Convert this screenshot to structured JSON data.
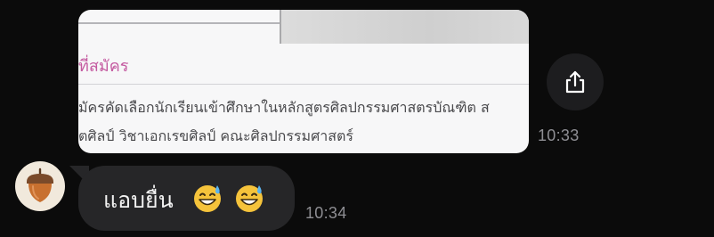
{
  "image_message": {
    "heading": "ที่สมัคร",
    "line1": "มัครคัดเลือกนักเรียนเข้าศึกษาในหลักสูตรศิลปกรรมศาสตรบัณฑิต ส",
    "line2": "ตศิลป์ วิชาเอกเรขศิลป์ คณะศิลปกรรมศาสตร์",
    "time": "10:33"
  },
  "share_button": {
    "icon": "share-icon"
  },
  "text_message": {
    "avatar_icon": "acorn-icon",
    "text": "แอบยื่น",
    "emoji": [
      "grinning-sweat-emoji",
      "grinning-sweat-emoji"
    ],
    "time": "10:34"
  },
  "colors": {
    "background": "#0b0b0b",
    "bubble": "#262628",
    "timestamp": "#8e8e93",
    "heading_pink": "#c45aa0"
  }
}
